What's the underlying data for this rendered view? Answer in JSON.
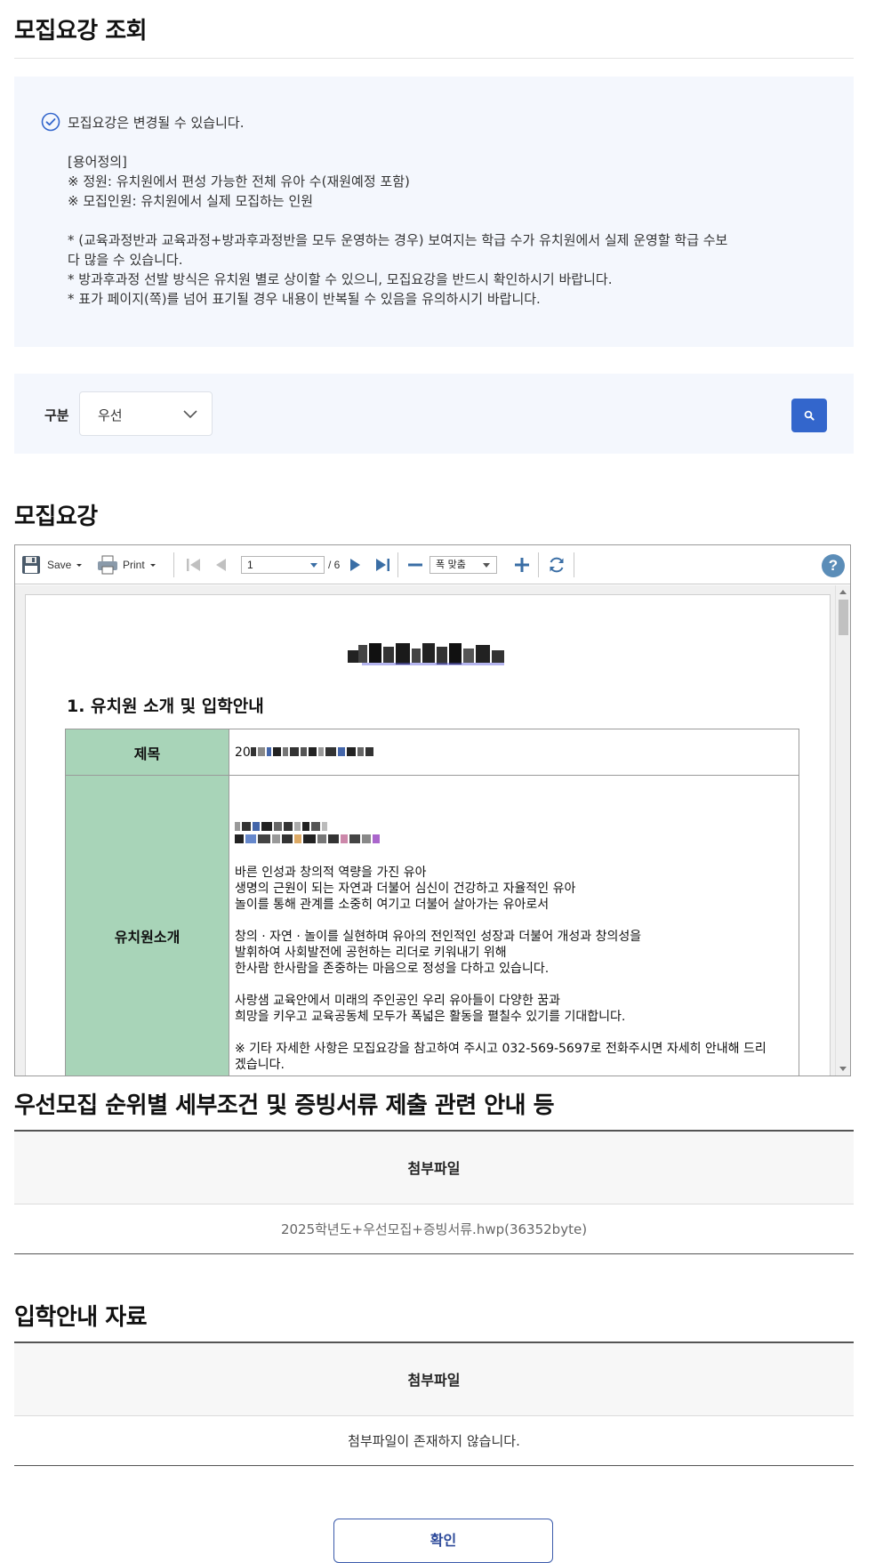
{
  "page": {
    "title": "모집요강 조회"
  },
  "notice": {
    "head": "모집요강은 변경될 수 있습니다.",
    "definitions_title": "[용어정의]",
    "definition_1": "※ 정원: 유치원에서 편성 가능한 전체 유아 수(재원예정 포함)",
    "definition_2": "※ 모집인원: 유치원에서 실제 모집하는 인원",
    "note_1": "* (교육과정반과 교육과정+방과후과정반을 모두 운영하는 경우) 보여지는 학급 수가 유치원에서 실제 운영할 학급 수보\n다 많을 수 있습니다.",
    "note_2": "* 방과후과정 선발 방식은 유치원 별로 상이할 수 있으니, 모집요강을 반드시 확인하시기 바랍니다.",
    "note_3": "* 표가 페이지(쪽)를 넘어 표기될 경우 내용이 반복될 수 있음을 유의하시기 바랍니다."
  },
  "filter": {
    "label": "구분",
    "selected": "우선"
  },
  "sections": {
    "guide_title": "모집요강",
    "priority_title": "우선모집 순위별 세부조건 및 증빙서류 제출 관련 안내 등",
    "admission_title": "입학안내 자료"
  },
  "viewer": {
    "save_label": "Save",
    "print_label": "Print",
    "page_current": "1",
    "page_total": "/ 6",
    "zoom_label": "폭 맞춤",
    "help_label": "?"
  },
  "document": {
    "section_heading": "1. 유치원 소개 및 입학안내",
    "row1_header": "제목",
    "row1_value_prefix": "20",
    "row2_header": "유치원소개",
    "intro_lines": [
      "바른 인성과 창의적 역량을 가진 유아",
      "생명의 근원이 되는 자연과 더불어 심신이 건강하고 자율적인 유아",
      "놀이를 통해 관계를 소중히 여기고 더불어 살아가는 유아로서",
      "창의 · 자연 · 놀이를 실현하며 유아의 전인적인 성장과 더불어 개성과 창의성을",
      "발휘하여 사회발전에 공헌하는 리더로 키워내기 위해",
      "한사람 한사람을 존중하는 마음으로 정성을 다하고 있습니다.",
      "사랑샘 교육안에서 미래의 주인공인 우리 유아들이 다양한 꿈과",
      "희망을 키우고 교육공동체 모두가 폭넓은 활동을 펼칠수 있기를 기대합니다.",
      "※ 기타 자세한 사항은 모집요강을 참고하여 주시고 032-569-5697로 전화주시면 자세히 안내해 드리",
      "겠습니다."
    ]
  },
  "priority_files": {
    "header": "첨부파일",
    "file": "2025학년도+우선모집+증빙서류.hwp(36352byte)"
  },
  "admission_files": {
    "header": "첨부파일",
    "empty": "첨부파일이 존재하지 않습니다."
  },
  "confirm_label": "확인",
  "colors": {
    "accent": "#3366cc",
    "table_header_green": "#a8d4b8",
    "panel_bg": "#f4f7fd"
  }
}
